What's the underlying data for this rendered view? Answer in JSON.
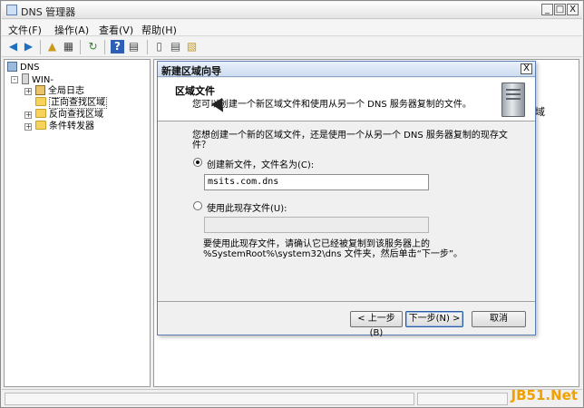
{
  "window": {
    "title": "DNS 管理器",
    "min_glyph": "_",
    "max_glyph": "□",
    "close_glyph": "X"
  },
  "menu": [
    "文件(F)",
    "操作(A)",
    "查看(V)",
    "帮助(H)"
  ],
  "toolbar_icons": [
    "back-arrow-icon",
    "forward-arrow-icon",
    "up-folder-icon",
    "show-hide-tree-icon",
    "refresh-icon",
    "help-icon",
    "properties-icon",
    "server-icon",
    "list-icon",
    "log-icon"
  ],
  "tree": {
    "root": "DNS",
    "server": "WIN-",
    "items": [
      "全局日志",
      "正向查找区域",
      "反向查找区域",
      "条件转发器"
    ],
    "expanders": [
      "□",
      "-",
      "+",
      "+",
      "+"
    ]
  },
  "right_pane": {
    "clipped_text": "域"
  },
  "dialog": {
    "title": "新建区域向导",
    "close": "X",
    "heading": "区域文件",
    "subheading": "您可以创建一个新区域文件和使用从另一个 DNS 服务器复制的文件。",
    "question": "您想创建一个新的区域文件，还是使用一个从另一个 DNS 服务器复制的现存文件？",
    "option_create": {
      "label": "创建新文件，文件名为(C):",
      "value": "msits.com.dns",
      "selected": true
    },
    "option_existing": {
      "label": "使用此现存文件(U):",
      "value": "",
      "selected": false
    },
    "note": "要使用此现存文件，请确认它已经被复制到该服务器上的 %SystemRoot%\\system32\\dns 文件夹，然后单击“下一步”。",
    "buttons": {
      "back": "< 上一步(B)",
      "next": "下一步(N) >",
      "cancel": "取消"
    }
  },
  "watermark": "JB51.Net",
  "colors": {
    "title_bar": "#e4e4e4",
    "dialog_border": "#5b7db0",
    "default_button": "#2b5aa3",
    "watermark": "#f0a000"
  }
}
